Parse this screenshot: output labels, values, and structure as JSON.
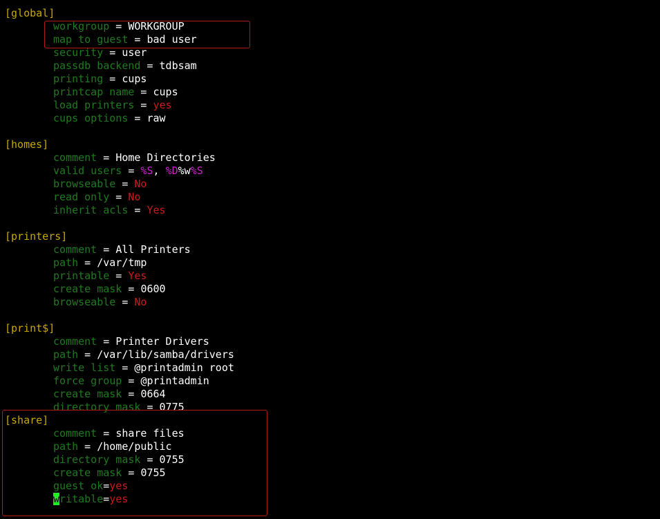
{
  "global": {
    "header": "[global]",
    "workgroup_key": "workgroup",
    "workgroup_val": "WORKGROUP",
    "map_key": "map to guest",
    "map_val": "bad user",
    "security_key": "security",
    "security_val": "user",
    "passdb_key": "passdb backend",
    "passdb_val": "tdbsam",
    "printing_key": "printing",
    "printing_val": "cups",
    "printcap_key": "printcap name",
    "printcap_val": "cups",
    "load_key": "load printers",
    "load_val": "yes",
    "cupsopt_key": "cups options",
    "cupsopt_val": "raw"
  },
  "homes": {
    "header": "[homes]",
    "comment_key": "comment",
    "comment_val": "Home Directories",
    "valid_key": "valid users",
    "valid_p1": "%S",
    "valid_p2": ", ",
    "valid_p3": "%D",
    "valid_p4": "%w",
    "valid_p5": "%S",
    "browse_key": "browseable",
    "browse_val": "No",
    "ro_key": "read only",
    "ro_val": "No",
    "acl_key": "inherit acls",
    "acl_val": "Yes"
  },
  "printers": {
    "header": "[printers]",
    "comment_key": "comment",
    "comment_val": "All Printers",
    "path_key": "path",
    "path_val": "/var/tmp",
    "printable_key": "printable",
    "printable_val": "Yes",
    "mask_key": "create mask",
    "mask_val": "0600",
    "browse_key": "browseable",
    "browse_val": "No"
  },
  "print_drv": {
    "header": "[print$]",
    "comment_key": "comment",
    "comment_val": "Printer Drivers",
    "path_key": "path",
    "path_val": "/var/lib/samba/drivers",
    "write_key": "write list",
    "write_val": "@printadmin root",
    "force_key": "force group",
    "force_val": "@printadmin",
    "cmask_key": "create mask",
    "cmask_val": "0664",
    "dmask_key": "directory mask",
    "dmask_val": "0775"
  },
  "share": {
    "header": "[share]",
    "comment_key": "comment",
    "comment_val": "share files",
    "path_key": "path",
    "path_val": "/home/public",
    "dmask_key": "directory mask",
    "dmask_val": "0755",
    "cmask_key": "create mask",
    "cmask_val": "0755",
    "guest_key": "guest ok",
    "guest_val": "yes",
    "writable_cursor": "w",
    "writable_rest": "ritable",
    "writable_val": "yes"
  },
  "colors": {
    "background": "#000000",
    "section": "#c8a800",
    "key": "#1e7a1e",
    "value": "#ffffff",
    "bool": "#cc1a1a",
    "macro": "#cc22cc",
    "cursor": "#22ee22",
    "highlight_box": "#b01818"
  }
}
